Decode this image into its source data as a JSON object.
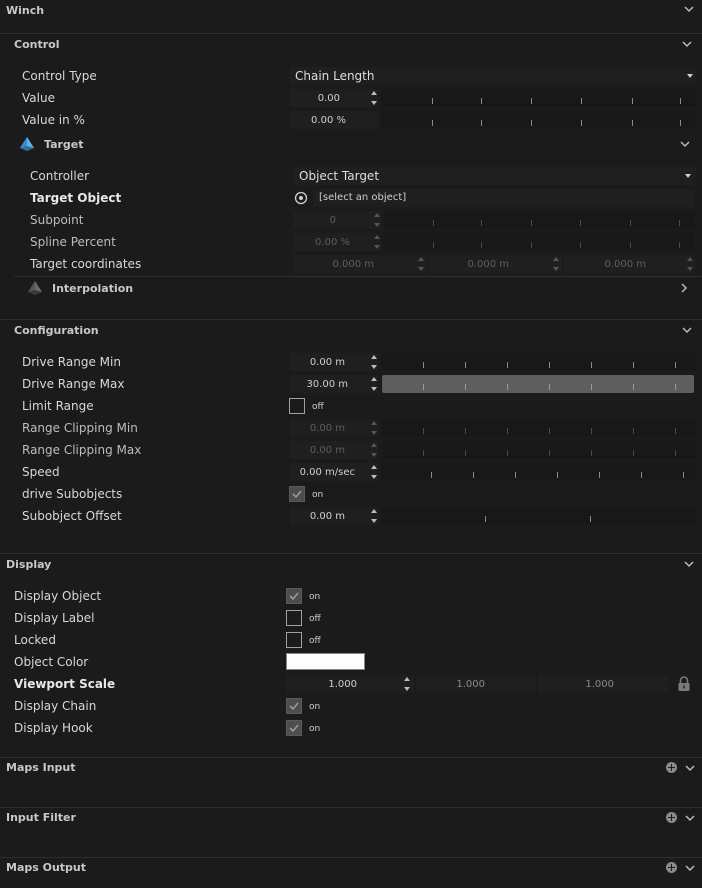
{
  "sections": {
    "winch": "Winch",
    "control": "Control",
    "target": "Target",
    "interpolation": "Interpolation",
    "configuration": "Configuration",
    "display": "Display",
    "maps_input": "Maps Input",
    "input_filter": "Input Filter",
    "maps_output": "Maps Output"
  },
  "control": {
    "control_type": {
      "label": "Control Type",
      "value": "Chain Length"
    },
    "value": {
      "label": "Value",
      "value": "0.00"
    },
    "value_pct": {
      "label": "Value in %",
      "value": "0.00 %"
    }
  },
  "target": {
    "controller": {
      "label": "Controller",
      "value": "Object Target"
    },
    "target_object": {
      "label": "Target Object",
      "value": "[select an object]"
    },
    "subpoint": {
      "label": "Subpoint",
      "value": "0"
    },
    "spline_percent": {
      "label": "Spline Percent",
      "value": "0.00 %"
    },
    "target_coords": {
      "label": "Target coordinates",
      "x": "0.000 m",
      "y": "0.000 m",
      "z": "0.000 m"
    }
  },
  "configuration": {
    "drive_range_min": {
      "label": "Drive Range Min",
      "value": "0.00 m"
    },
    "drive_range_max": {
      "label": "Drive Range Max",
      "value": "30.00 m"
    },
    "limit_range": {
      "label": "Limit Range",
      "state": "off"
    },
    "range_clip_min": {
      "label": "Range Clipping Min",
      "value": "0.00 m"
    },
    "range_clip_max": {
      "label": "Range Clipping Max",
      "value": "0.00 m"
    },
    "speed": {
      "label": "Speed",
      "value": "0.00 m/sec"
    },
    "drive_subobjects": {
      "label": "drive Subobjects",
      "state": "on"
    },
    "subobject_offset": {
      "label": "Subobject Offset",
      "value": "0.00 m"
    }
  },
  "display": {
    "display_object": {
      "label": "Display Object",
      "state": "on"
    },
    "display_label": {
      "label": "Display Label",
      "state": "off"
    },
    "locked": {
      "label": "Locked",
      "state": "off"
    },
    "object_color": {
      "label": "Object Color",
      "color": "#ffffff"
    },
    "viewport_scale": {
      "label": "Viewport Scale",
      "x": "1.000",
      "y": "1.000",
      "z": "1.000"
    },
    "display_chain": {
      "label": "Display Chain",
      "state": "on"
    },
    "display_hook": {
      "label": "Display Hook",
      "state": "on"
    }
  },
  "icons": {
    "collapse": "chevron-down-icon",
    "expand": "chevron-right-icon",
    "add": "plus-circle-icon",
    "lock": "lock-icon",
    "pick": "target-pick-icon",
    "dropdown": "caret-down-icon"
  },
  "colors": {
    "background": "#1b1b1b",
    "panel_line": "#2e2e2e",
    "filled_slider": "#5e5e5e",
    "target_icon": "#4aa3e0"
  }
}
